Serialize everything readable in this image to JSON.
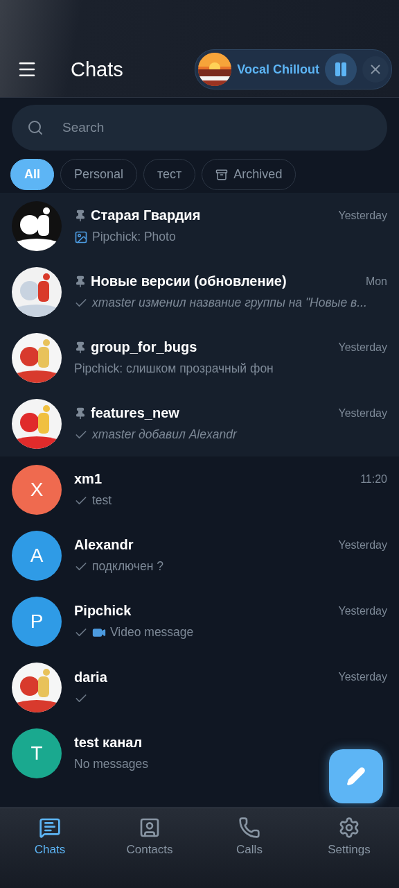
{
  "header": {
    "title": "Chats"
  },
  "player": {
    "title": "Vocal Chillout",
    "playing": true
  },
  "search": {
    "placeholder": "Search"
  },
  "filters": [
    {
      "label": "All",
      "selected": true,
      "kind": "plain"
    },
    {
      "label": "Personal",
      "selected": false,
      "kind": "plain"
    },
    {
      "label": "тест",
      "selected": false,
      "kind": "plain"
    },
    {
      "label": "Archived",
      "selected": false,
      "kind": "archive"
    }
  ],
  "chats": [
    {
      "name": "Старая Гвардия",
      "time": "Yesterday",
      "message": "Pipchick: Photo",
      "pinned": true,
      "photo": true
    },
    {
      "name": "Новые версии (обновление)",
      "time": "Mon",
      "message": "xmaster изменил название группы на \"Новые в...",
      "pinned": true,
      "sent": true,
      "italic": true
    },
    {
      "name": "group_for_bugs",
      "time": "Yesterday",
      "message": "Pipchick: слишком прозрачный фон",
      "pinned": true
    },
    {
      "name": "features_new",
      "time": "Yesterday",
      "message": "xmaster добавил Alexandr",
      "pinned": true,
      "sent": true,
      "italic": true
    },
    {
      "name": "xm1",
      "time": "11:20",
      "message": "test",
      "sent": true,
      "avatar": {
        "kind": "letter",
        "letter": "X",
        "color": "#ef6a4f"
      }
    },
    {
      "name": "Alexandr",
      "time": "Yesterday",
      "message": "подключен ?",
      "sent": true,
      "avatar": {
        "kind": "letter",
        "letter": "A",
        "color": "#2f9be6"
      }
    },
    {
      "name": "Pipchick",
      "time": "Yesterday",
      "message": "Video message",
      "sent": true,
      "video": true,
      "avatar": {
        "kind": "letter",
        "letter": "P",
        "color": "#2f9be6"
      }
    },
    {
      "name": "daria",
      "time": "Yesterday",
      "sent": true
    },
    {
      "name": "test канал",
      "message": "No messages",
      "avatar": {
        "kind": "letter",
        "letter": "T",
        "color": "#1aa98f"
      }
    }
  ],
  "nav": [
    {
      "label": "Chats",
      "selected": true,
      "kind": "chats"
    },
    {
      "label": "Contacts",
      "selected": false,
      "kind": "contacts"
    },
    {
      "label": "Calls",
      "selected": false,
      "kind": "calls"
    },
    {
      "label": "Settings",
      "selected": false,
      "kind": "settings"
    }
  ]
}
